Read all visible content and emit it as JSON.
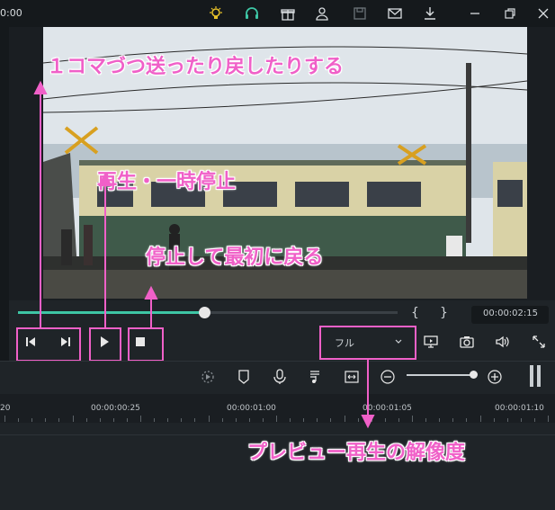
{
  "titlebar": {
    "time": "0:00",
    "icons": [
      "bulb-icon",
      "headset-icon",
      "gift-icon",
      "user-icon",
      "save-icon",
      "mail-icon",
      "download-icon",
      "minimize-icon",
      "restore-icon",
      "close-icon"
    ]
  },
  "player": {
    "progress_fraction": 0.49,
    "mark_in": "{",
    "mark_out": "}",
    "timecode": "00:00:02:15",
    "resolution": "フル"
  },
  "timeline": {
    "ticks": [
      "20",
      "00:00:00:25",
      "00:00:01:00",
      "00:00:01:05",
      "00:00:01:10"
    ]
  },
  "annotations": {
    "frame_step": "１コマづつ送ったり戻したりする",
    "play_pause": "再生・一時停止",
    "stop": "停止して最初に戻る",
    "resolution": "プレビュー再生の解像度"
  },
  "colors": {
    "accent": "#3ec6a5",
    "annotation": "#f060c8",
    "background": "#1f2428"
  }
}
